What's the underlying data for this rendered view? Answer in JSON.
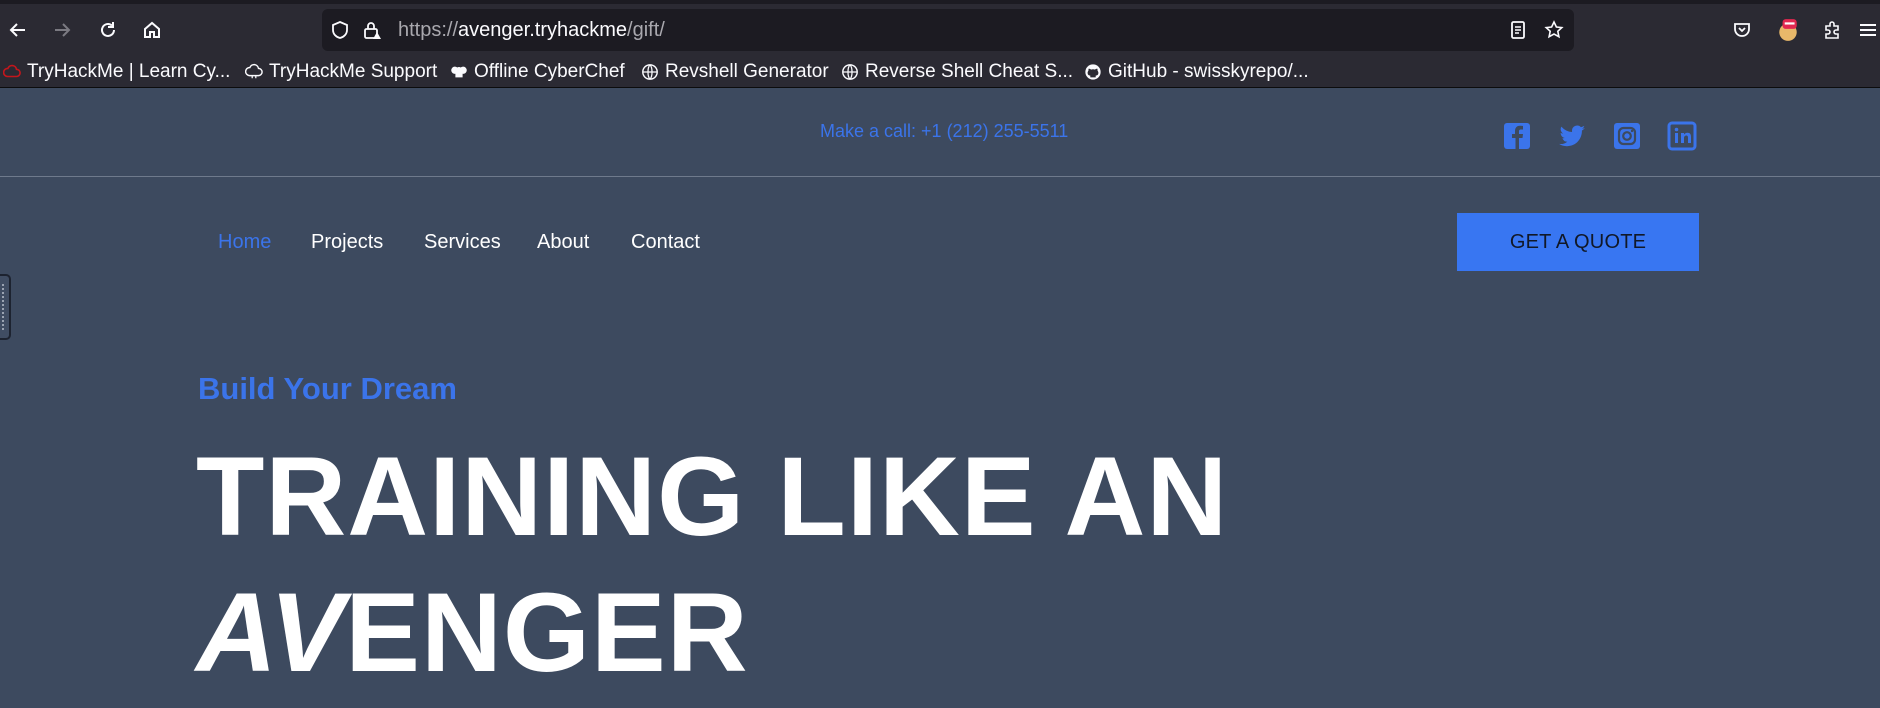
{
  "browser": {
    "url_scheme": "https://",
    "url_host": "avenger.tryhackme",
    "url_path": "/gift/",
    "bookmarks": [
      {
        "label": "TryHackMe | Learn Cy...",
        "icon": "cloud-icon"
      },
      {
        "label": "TryHackMe Support",
        "icon": "cloud-outline-icon"
      },
      {
        "label": "Offline CyberChef",
        "icon": "chef-hat-icon"
      },
      {
        "label": "Revshell Generator",
        "icon": "globe-icon"
      },
      {
        "label": "Reverse Shell Cheat S...",
        "icon": "globe-icon"
      },
      {
        "label": "GitHub - swisskyrepo/...",
        "icon": "github-icon"
      }
    ]
  },
  "site": {
    "call_text": "Make a call: +1 (212) 255-5511",
    "social": [
      "facebook-icon",
      "twitter-icon",
      "instagram-icon",
      "linkedin-icon"
    ],
    "nav": [
      {
        "label": "Home",
        "active": true
      },
      {
        "label": "Projects"
      },
      {
        "label": "Services"
      },
      {
        "label": "About"
      },
      {
        "label": "Contact"
      }
    ],
    "quote_label": "GET A QUOTE",
    "eyebrow": "Build Your Dream",
    "hero_line1": "TRAINING LIKE AN",
    "hero_line2_italic": "AV",
    "hero_line2_rest": "ENGER"
  },
  "colors": {
    "accent": "#3876f2",
    "page_bg": "#3d4a5f",
    "chrome_bg": "#2b2a33",
    "urlbar_bg": "#1c1b22"
  }
}
